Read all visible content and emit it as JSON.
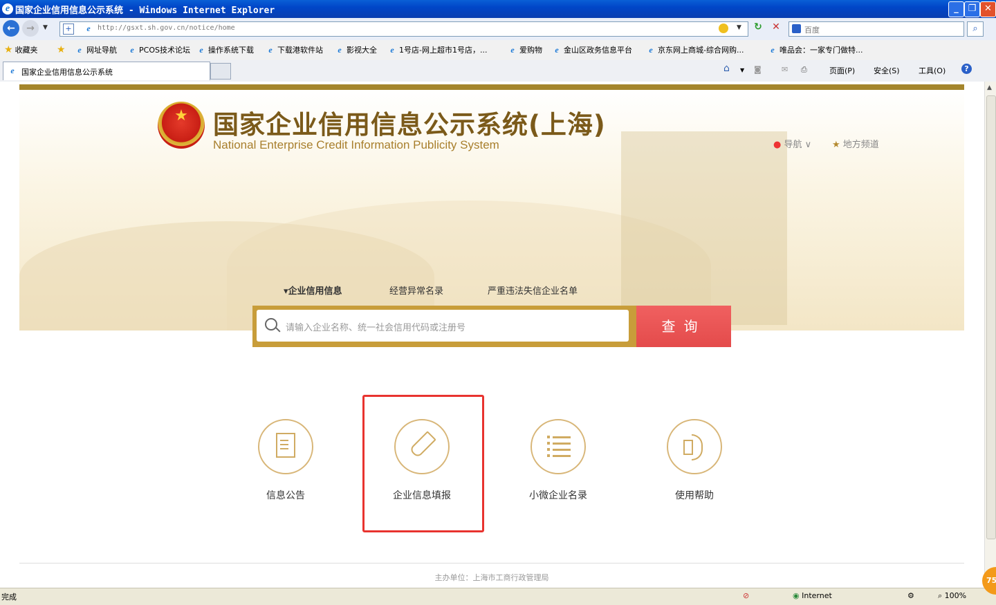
{
  "window": {
    "title": "国家企业信用信息公示系统 - Windows Internet Explorer",
    "minimize": "_",
    "restore": "❐",
    "close": "✕"
  },
  "address": {
    "url": "http://gsxt.sh.gov.cn/notice/home",
    "search_placeholder": "百度"
  },
  "favorites": {
    "label": "收藏夹",
    "items": [
      "网址导航",
      "PCOS技术论坛",
      "操作系统下载",
      "下载港软件站",
      "影视大全",
      "1号店-网上超市1号店，...",
      "爱购物",
      "金山区政务信息平台",
      "京东网上商城-综合网购...",
      "唯品会：一家专门做特..."
    ]
  },
  "tabs": {
    "active_label": "国家企业信用信息公示系统"
  },
  "toolbar": {
    "page": "页面(P)",
    "safety": "安全(S)",
    "tools": "工具(O)"
  },
  "site": {
    "title": "国家企业信用信息公示系统(上海)",
    "subtitle": "National Enterprise Credit Information Publicity System",
    "nav_label": "导航",
    "local_label": "地方频道"
  },
  "search": {
    "tabs": [
      "▾企业信用信息",
      "经营异常名录",
      "严重违法失信企业名单"
    ],
    "placeholder": "请输入企业名称、统一社会信用代码或注册号",
    "button": "查询"
  },
  "features": [
    "信息公告",
    "企业信息填报",
    "小微企业名录",
    "使用帮助"
  ],
  "footer": {
    "text": "主办单位：上海市工商行政管理局"
  },
  "status": {
    "left": "完成",
    "zone": "Internet",
    "zoom": "100%",
    "badge": "75"
  }
}
